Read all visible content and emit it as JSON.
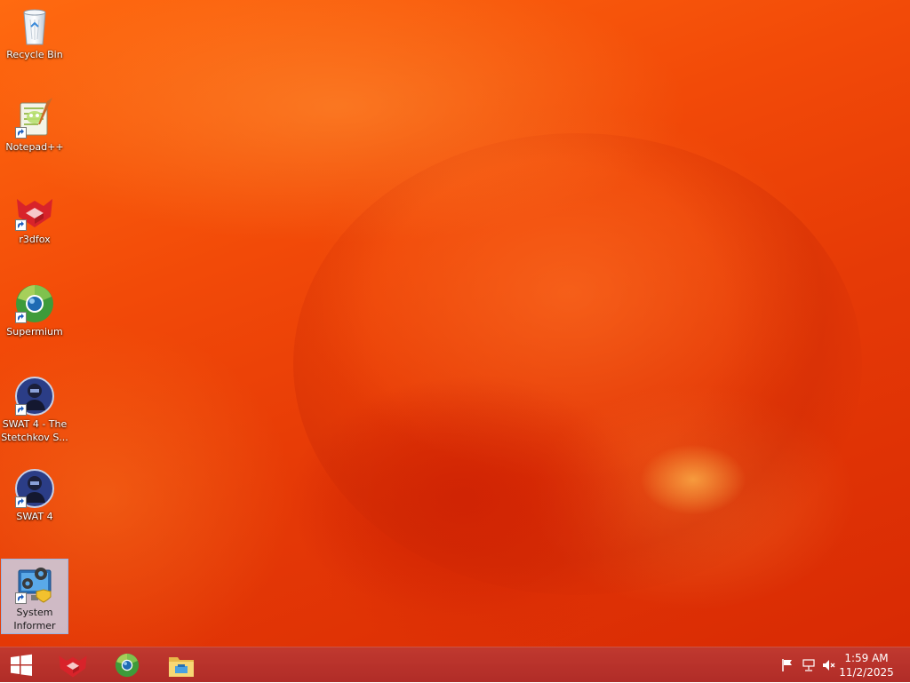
{
  "desktop": {
    "icons": [
      {
        "label": "Recycle Bin",
        "icon": "recycle-bin-icon",
        "shortcut": false,
        "selected": false
      },
      {
        "label": "Notepad++",
        "icon": "notepad-plus-plus-icon",
        "shortcut": true,
        "selected": false
      },
      {
        "label": "r3dfox",
        "icon": "r3dfox-icon",
        "shortcut": true,
        "selected": false
      },
      {
        "label": "Supermium",
        "icon": "supermium-icon",
        "shortcut": true,
        "selected": false
      },
      {
        "label": "SWAT 4 - The Stetchkov S...",
        "icon": "swat4-stetchkov-icon",
        "shortcut": true,
        "selected": false
      },
      {
        "label": "SWAT 4",
        "icon": "swat4-icon",
        "shortcut": true,
        "selected": false
      },
      {
        "label": "System Informer",
        "icon": "system-informer-icon",
        "shortcut": true,
        "selected": true
      }
    ]
  },
  "taskbar": {
    "start_icon": "windows-logo-icon",
    "pinned": [
      {
        "name": "r3dfox",
        "icon": "r3dfox-icon"
      },
      {
        "name": "Supermium",
        "icon": "supermium-icon"
      },
      {
        "name": "File Explorer",
        "icon": "file-explorer-icon"
      }
    ],
    "tray": {
      "icons": [
        "action-center-flag-icon",
        "network-icon",
        "volume-muted-icon"
      ],
      "time": "1:59 AM",
      "date": "11/2/2025"
    }
  },
  "colors": {
    "wallpaper_primary": "#ef4a08",
    "taskbar": "#b3302a",
    "selection": "#c8dcf8"
  }
}
